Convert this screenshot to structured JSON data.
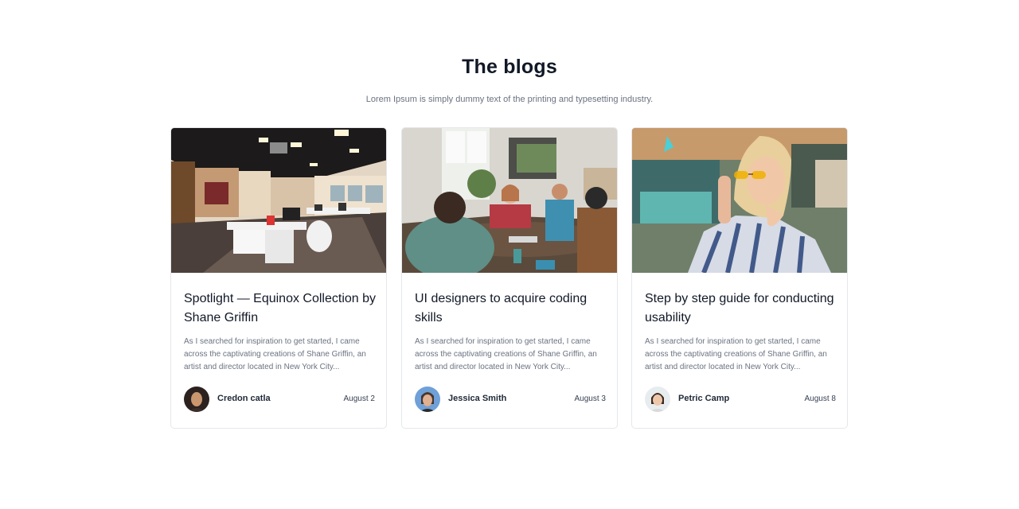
{
  "section": {
    "title": "The blogs",
    "subtitle": "Lorem Ipsum is simply dummy text of the printing and typesetting industry."
  },
  "posts": [
    {
      "title": "Spotlight — Equinox Collection by Shane Griffin",
      "excerpt": "As I searched for inspiration to get started, I came across the captivating creations of Shane Griffin, an artist and director located in New York City...",
      "author": "Credon catla",
      "date": "August 2",
      "image": "office-interior-photo"
    },
    {
      "title": "UI designers to acquire coding skills",
      "excerpt": "As I searched for inspiration to get started, I came across the captivating creations of Shane Griffin, an artist and director located in New York City...",
      "author": "Jessica Smith",
      "date": "August 3",
      "image": "team-meeting-photo"
    },
    {
      "title": "Step by step guide for conducting usability",
      "excerpt": "As I searched for inspiration to get started, I came across the captivating creations of Shane Griffin, an artist and director located in New York City...",
      "author": "Petric Camp",
      "date": "August 8",
      "image": "woman-sunglasses-photo"
    }
  ]
}
